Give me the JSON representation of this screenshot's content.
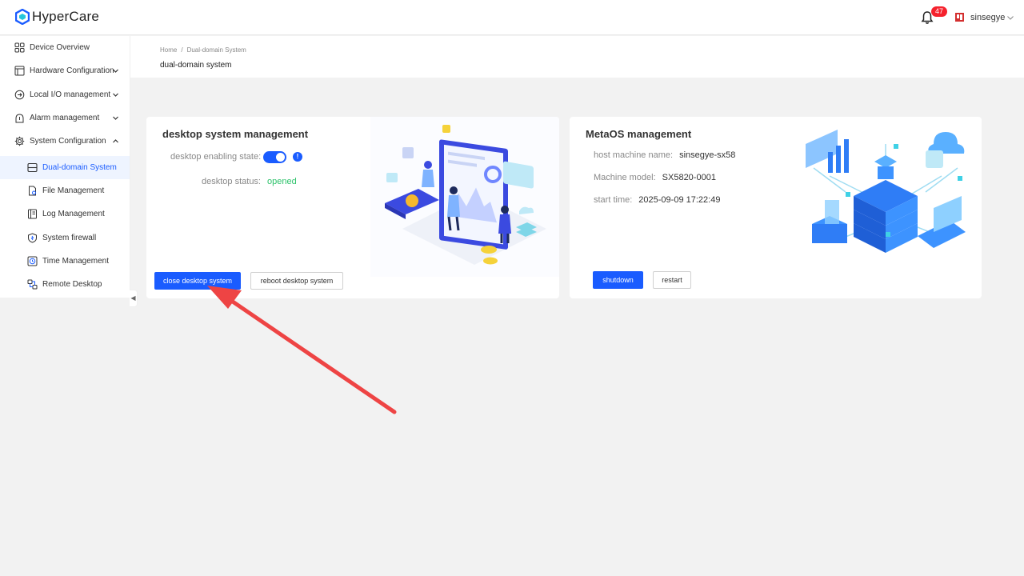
{
  "header": {
    "app_name": "HyperCare",
    "notification_count": "47",
    "username": "sinsegye",
    "icons": {
      "logo": "hypercare-logo-icon",
      "bell": "bell-icon",
      "avatar": "user-avatar-icon",
      "caret": "chevron-down-icon"
    }
  },
  "sidebar": {
    "items": [
      {
        "label": "Device Overview",
        "icon": "grid-icon"
      },
      {
        "label": "Hardware Configuration",
        "icon": "hardware-icon",
        "expandable": true
      },
      {
        "label": "Local I/O management",
        "icon": "io-icon",
        "expandable": true
      },
      {
        "label": "Alarm management",
        "icon": "alarm-icon",
        "expandable": true
      },
      {
        "label": "System Configuration",
        "icon": "gear-icon",
        "expanded": true
      }
    ],
    "sub_items": [
      {
        "label": "Dual-domain System",
        "icon": "dual-domain-icon",
        "active": true
      },
      {
        "label": "File Management",
        "icon": "file-icon"
      },
      {
        "label": "Log Management",
        "icon": "log-icon"
      },
      {
        "label": "System firewall",
        "icon": "shield-icon"
      },
      {
        "label": "Time Management",
        "icon": "clock-icon"
      },
      {
        "label": "Remote Desktop",
        "icon": "remote-desktop-icon"
      }
    ]
  },
  "breadcrumb": {
    "home": "Home",
    "separator": "/",
    "current": "Dual-domain System"
  },
  "page_title": "dual-domain system",
  "desktop_card": {
    "title": "desktop system management",
    "enabling_state_label": "desktop enabling state:",
    "enabling_state_on": true,
    "status_label": "desktop status:",
    "status_value": "opened",
    "close_button": "close desktop system",
    "reboot_button": "reboot desktop system"
  },
  "meta_card": {
    "title": "MetaOS management",
    "host_label": "host machine name:",
    "host_value": "sinsegye-sx58",
    "model_label": "Machine model:",
    "model_value": "SX5820-0001",
    "start_label": "start time:",
    "start_value": "2025-09-09 17:22:49",
    "shutdown_button": "shutdown",
    "restart_button": "restart"
  },
  "colors": {
    "primary": "#1a5cff",
    "status_green": "#2dc26b",
    "badge_red": "#f5222d",
    "annotation_arrow": "#ee4444"
  }
}
